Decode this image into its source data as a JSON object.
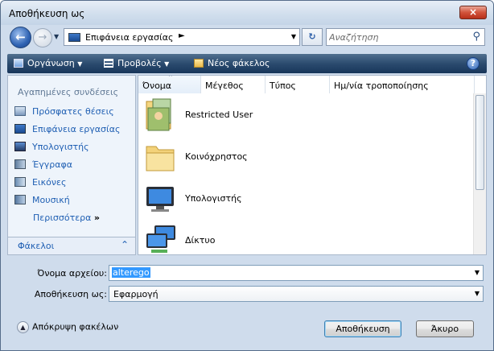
{
  "window": {
    "title": "Αποθήκευση ως",
    "close_label": "×"
  },
  "nav": {
    "location": "Επιφάνεια εργασίας",
    "search_placeholder": "Αναζήτηση"
  },
  "toolbar": {
    "organize": "Οργάνωση",
    "views": "Προβολές",
    "new_folder": "Νέος φάκελος",
    "help": "?"
  },
  "sidebar": {
    "header": "Αγαπημένες συνδέσεις",
    "links": [
      {
        "label": "Πρόσφατες θέσεις",
        "icon": "recent-places-icon"
      },
      {
        "label": "Επιφάνεια εργασίας",
        "icon": "desktop-icon"
      },
      {
        "label": "Υπολογιστής",
        "icon": "computer-icon"
      },
      {
        "label": "Έγγραφα",
        "icon": "documents-icon"
      },
      {
        "label": "Εικόνες",
        "icon": "pictures-icon"
      },
      {
        "label": "Μουσική",
        "icon": "music-icon"
      }
    ],
    "more": "Περισσότερα",
    "folders": "Φάκελοι"
  },
  "columns": [
    "Όνομα",
    "Μέγεθος",
    "Τύπος",
    "Ημ/νία τροποποίησης"
  ],
  "items": [
    {
      "label": "Restricted User",
      "icon": "user-folder-icon"
    },
    {
      "label": "Κοινόχρηστος",
      "icon": "folder-icon"
    },
    {
      "label": "Υπολογιστής",
      "icon": "computer-icon"
    },
    {
      "label": "Δίκτυο",
      "icon": "network-icon"
    }
  ],
  "form": {
    "filename_label": "Όνομα αρχείου:",
    "filename_value": "alterego",
    "savetype_label": "Αποθήκευση ως:",
    "savetype_value": "Εφαρμογή",
    "hide_folders": "Απόκρυψη φακέλων",
    "save_button": "Αποθήκευση",
    "cancel_button": "Άκυρο"
  },
  "colors": {
    "link": "#1f5fb3",
    "toolbar": "#2b4b6f",
    "selection": "#3399ff"
  }
}
